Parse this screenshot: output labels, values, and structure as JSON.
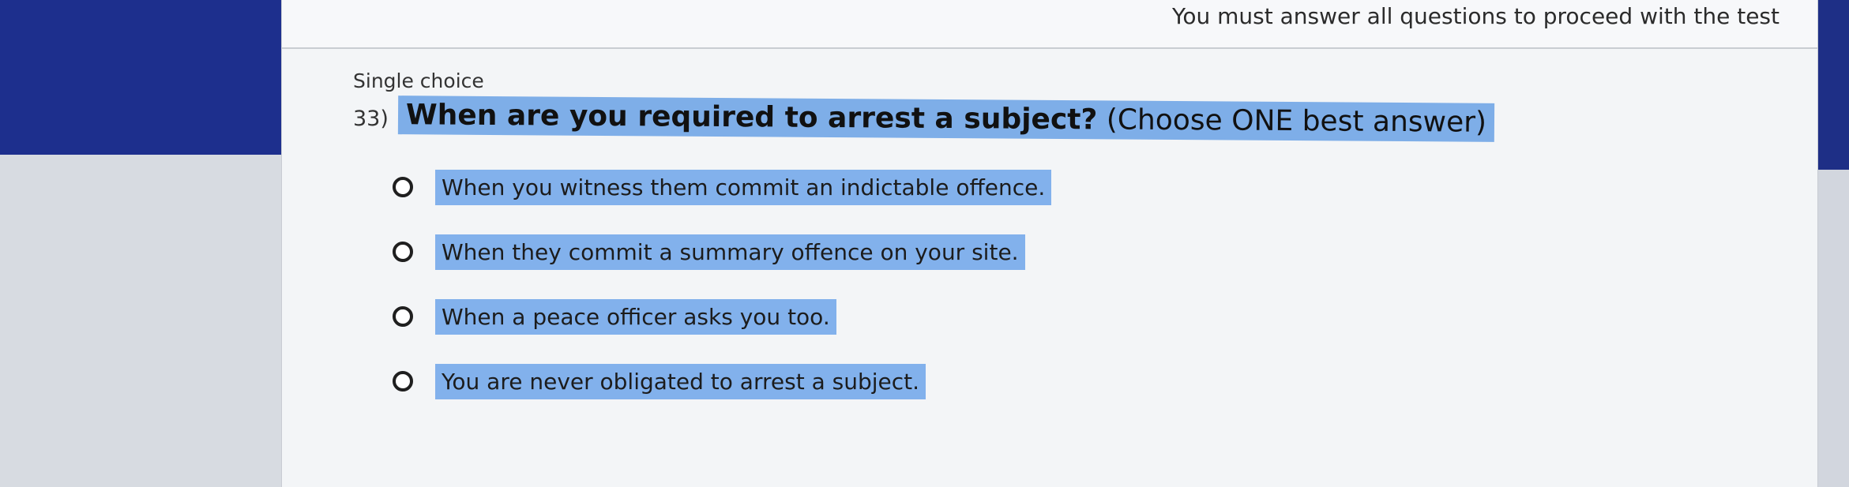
{
  "header": {
    "notice": "You must answer all questions to proceed with the test"
  },
  "question": {
    "type_label": "Single choice",
    "number": "33)",
    "text": "When are you required to arrest a subject?",
    "hint": "(Choose ONE best answer)",
    "options": [
      {
        "label": "When you witness them commit an indictable offence."
      },
      {
        "label": "When they commit a summary offence on your site."
      },
      {
        "label": "When a peace officer asks you too."
      },
      {
        "label": "You are never obligated to arrest a subject."
      }
    ]
  },
  "colors": {
    "selection_highlight": "#82b1ec",
    "frame_blue": "#1d2f8d"
  }
}
